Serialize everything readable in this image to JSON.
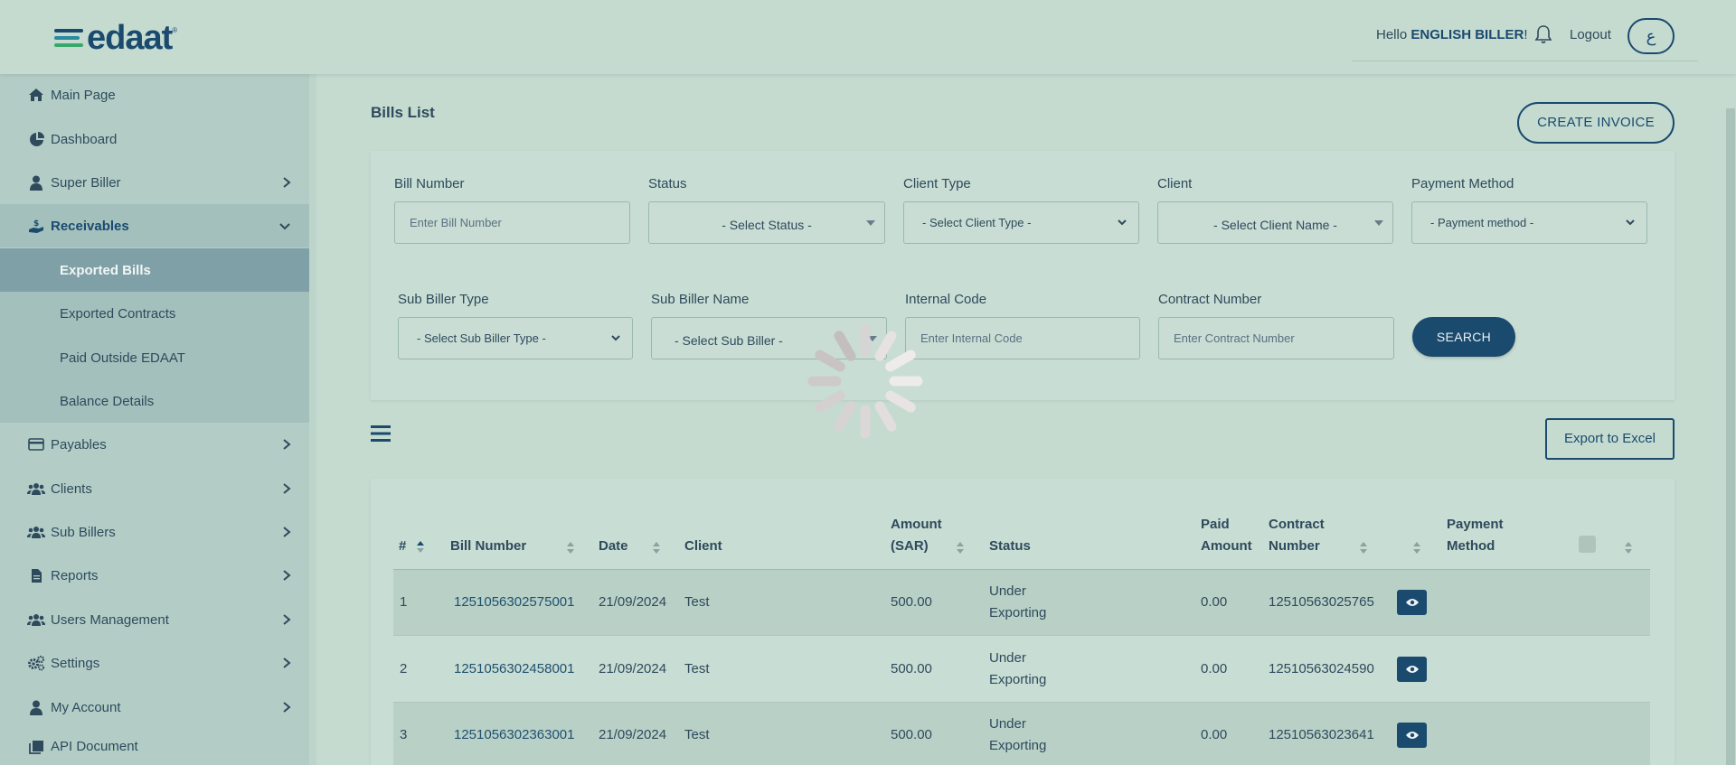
{
  "header": {
    "logo_text": "edaat",
    "logo_tm": "®",
    "greeting_prefix": "Hello ",
    "user_name": "ENGLISH BILLER",
    "greeting_suffix": "!",
    "logout_label": "Logout",
    "language_toggle": "ع",
    "colors": {
      "brand": "#1a4a6e",
      "logo_green": "#3aa86b",
      "logo_teal": "#2a8a9e"
    }
  },
  "sidebar": {
    "items": [
      {
        "label": "Main Page",
        "icon": "home-icon"
      },
      {
        "label": "Dashboard",
        "icon": "pie-chart-icon"
      },
      {
        "label": "Super Biller",
        "icon": "user-icon"
      },
      {
        "label": "Receivables",
        "icon": "hand-money-icon"
      },
      {
        "label": "Payables",
        "icon": "credit-card-icon"
      },
      {
        "label": "Clients",
        "icon": "users-icon"
      },
      {
        "label": "Sub Billers",
        "icon": "users-icon"
      },
      {
        "label": "Reports",
        "icon": "file-icon"
      },
      {
        "label": "Users Management",
        "icon": "users-icon"
      },
      {
        "label": "Settings",
        "icon": "gears-icon"
      },
      {
        "label": "My Account",
        "icon": "user-icon"
      },
      {
        "label": "API Document",
        "icon": "book-icon"
      }
    ],
    "receivables_sub": [
      {
        "label": "Exported Bills"
      },
      {
        "label": "Exported Contracts"
      },
      {
        "label": "Paid Outside EDAAT"
      },
      {
        "label": "Balance Details"
      }
    ]
  },
  "page": {
    "title": "Bills List",
    "create_button": "CREATE INVOICE",
    "export_button": "Export to Excel"
  },
  "filters": {
    "bill_number": {
      "label": "Bill Number",
      "placeholder": "Enter Bill Number"
    },
    "status": {
      "label": "Status",
      "value": "- Select Status -"
    },
    "client_type": {
      "label": "Client Type",
      "value": "- Select Client Type -"
    },
    "client": {
      "label": "Client",
      "value": "- Select Client Name -"
    },
    "payment_method": {
      "label": "Payment Method",
      "value": "- Payment method -"
    },
    "sub_biller_type": {
      "label": "Sub Biller Type",
      "value": "- Select Sub Biller Type -"
    },
    "sub_biller_name": {
      "label": "Sub Biller Name",
      "value": "- Select Sub Biller -"
    },
    "internal_code": {
      "label": "Internal Code",
      "placeholder": "Enter Internal Code"
    },
    "contract_number": {
      "label": "Contract Number",
      "placeholder": "Enter Contract Number"
    },
    "search_button": "SEARCH"
  },
  "table": {
    "columns": {
      "index": "#",
      "bill_number": "Bill Number",
      "date": "Date",
      "client": "Client",
      "amount_l1": "Amount",
      "amount_l2": "(SAR)",
      "status": "Status",
      "paid_l1": "Paid",
      "paid_l2": "Amount",
      "contract_l1": "Contract",
      "contract_l2": "Number",
      "payment_l1": "Payment",
      "payment_l2": "Method"
    },
    "rows": [
      {
        "index": "1",
        "bill_number": "1251056302575001",
        "date": "21/09/2024",
        "client": "Test",
        "amount": "500.00",
        "status_l1": "Under",
        "status_l2": "Exporting",
        "paid": "0.00",
        "contract": "12510563025765"
      },
      {
        "index": "2",
        "bill_number": "1251056302458001",
        "date": "21/09/2024",
        "client": "Test",
        "amount": "500.00",
        "status_l1": "Under",
        "status_l2": "Exporting",
        "paid": "0.00",
        "contract": "12510563024590"
      },
      {
        "index": "3",
        "bill_number": "1251056302363001",
        "date": "21/09/2024",
        "client": "Test",
        "amount": "500.00",
        "status_l1": "Under",
        "status_l2": "Exporting",
        "paid": "0.00",
        "contract": "12510563023641"
      }
    ]
  }
}
